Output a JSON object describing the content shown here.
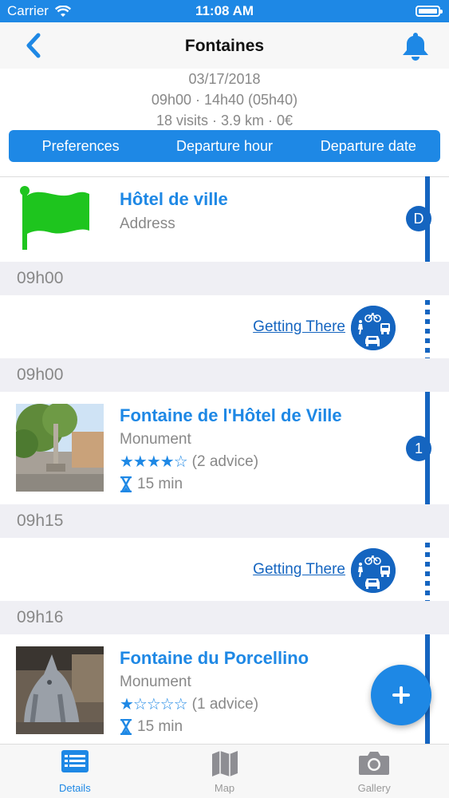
{
  "status_bar": {
    "carrier": "Carrier",
    "time": "11:08 AM"
  },
  "nav": {
    "title": "Fontaines",
    "back_icon": "chevron-left-icon",
    "bell_icon": "bell-icon"
  },
  "summary": {
    "date": "03/17/2018",
    "hours": "09h00 · 14h40 (05h40)",
    "stats": "18 visits · 3.9 km · 0€"
  },
  "segments": [
    "Preferences",
    "Departure hour",
    "Departure date"
  ],
  "start": {
    "name": "Hôtel de ville",
    "address": "Address",
    "badge": "D",
    "icon": "green-flag-icon"
  },
  "times": [
    "09h00",
    "09h00",
    "09h15",
    "09h16"
  ],
  "getting_there": "Getting There",
  "visits": [
    {
      "name": "Fontaine de l'Hôtel de Ville",
      "category": "Monument",
      "stars": "★★★★☆",
      "rating": 4,
      "advice": "(2 advice)",
      "duration": "15 min",
      "badge": "1"
    },
    {
      "name": "Fontaine du Porcellino",
      "category": "Monument",
      "stars": "★☆☆☆☆",
      "rating": 1,
      "advice": "(1 advice)",
      "duration": "15 min",
      "badge": ""
    }
  ],
  "tabs": [
    {
      "label": "Details",
      "icon": "list-icon",
      "active": true
    },
    {
      "label": "Map",
      "icon": "map-icon",
      "active": false
    },
    {
      "label": "Gallery",
      "icon": "camera-icon",
      "active": false
    }
  ],
  "colors": {
    "accent": "#1e88e5",
    "dark": "#1565c0",
    "flag": "#1ec51e"
  }
}
